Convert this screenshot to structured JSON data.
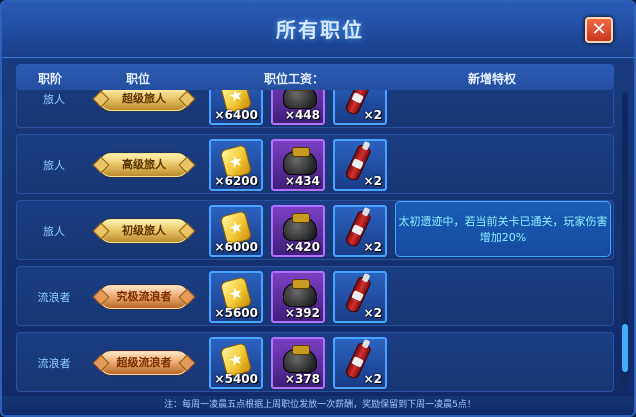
{
  "title": "所有职位",
  "close_icon": "close-icon",
  "header": {
    "rank": "职阶",
    "position": "职位",
    "salary": "职位工资：",
    "privilege": "新增特权"
  },
  "rows": [
    {
      "rank": "旅人",
      "position": "超级旅人",
      "items": [
        {
          "icon": "gold-ticket-icon",
          "count": "×6400"
        },
        {
          "icon": "bag-icon",
          "count": "×448"
        },
        {
          "icon": "bottle-icon",
          "count": "×2"
        }
      ]
    },
    {
      "rank": "旅人",
      "position": "高级旅人",
      "items": [
        {
          "icon": "gold-ticket-icon",
          "count": "×6200"
        },
        {
          "icon": "bag-icon",
          "count": "×434"
        },
        {
          "icon": "bottle-icon",
          "count": "×2"
        }
      ]
    },
    {
      "rank": "旅人",
      "position": "初级旅人",
      "items": [
        {
          "icon": "gold-ticket-icon",
          "count": "×6000"
        },
        {
          "icon": "bag-icon",
          "count": "×420"
        },
        {
          "icon": "bottle-icon",
          "count": "×2"
        }
      ],
      "privilege": "太初遗迹中，若当前关卡已通关，玩家伤害增加20%"
    },
    {
      "rank": "流浪者",
      "position": "究极流浪者",
      "items": [
        {
          "icon": "gold-ticket-icon",
          "count": "×5600"
        },
        {
          "icon": "bag-icon",
          "count": "×392"
        },
        {
          "icon": "bottle-icon",
          "count": "×2"
        }
      ]
    },
    {
      "rank": "流浪者",
      "position": "超级流浪者",
      "items": [
        {
          "icon": "gold-ticket-icon",
          "count": "×5400"
        },
        {
          "icon": "bag-icon",
          "count": "×378"
        },
        {
          "icon": "bottle-icon",
          "count": "×2"
        }
      ]
    }
  ],
  "footer": "注：每周一凌晨五点根据上周职位发放一次薪酬，奖励保留到下周一凌晨5点！"
}
